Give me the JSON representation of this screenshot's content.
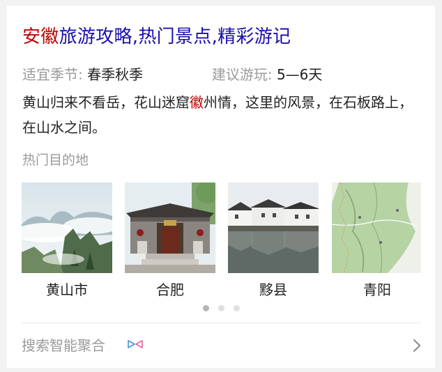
{
  "card": {
    "title_highlight": "安徽",
    "title_rest": "旅游攻略,热门景点,精彩游记",
    "meta": {
      "season_label": "适宜季节:",
      "season_value": "春季秋季",
      "duration_label": "建议游玩:",
      "duration_value": "5—6天"
    },
    "description": {
      "before": "黄山归来不看岳，花山迷窟",
      "highlight": "徽",
      "after": "州情，这里的风景，在石板路上，在山水之间。"
    },
    "section_label": "热门目的地",
    "destinations": [
      {
        "name": "黄山市",
        "icon": "mountain-photo"
      },
      {
        "name": "合肥",
        "icon": "temple-photo"
      },
      {
        "name": "黟县",
        "icon": "village-photo"
      },
      {
        "name": "青阳",
        "icon": "map-photo"
      }
    ],
    "carousel": {
      "pages": 3,
      "active_page": 1
    },
    "footer": {
      "label": "搜索智能聚合",
      "icon": "bowtie-icon",
      "arrow_icon": "chevron-right-icon"
    }
  },
  "colors": {
    "title_link": "#1a0dab",
    "highlight": "#c00000",
    "muted_text": "#9a9a9a",
    "body_text": "#222222",
    "bowtie_accent": "#4a90e2"
  }
}
